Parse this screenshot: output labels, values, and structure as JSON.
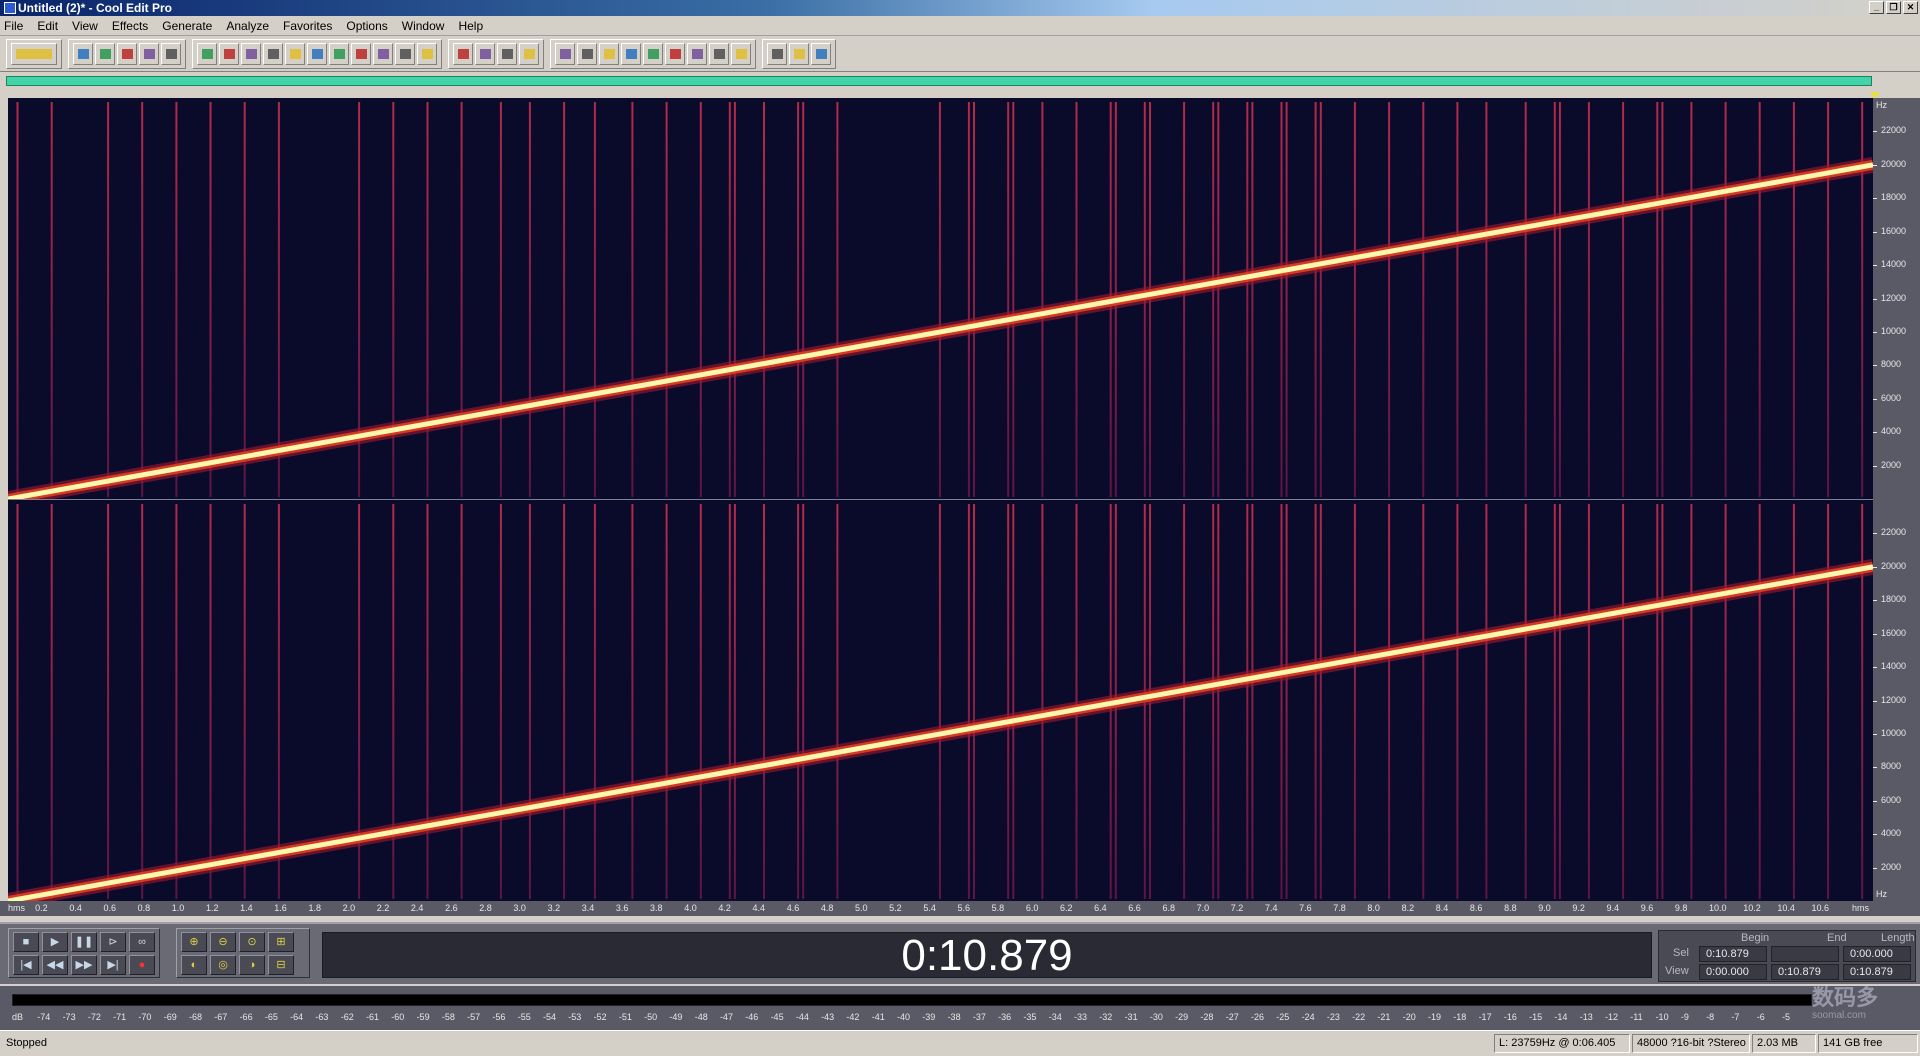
{
  "window": {
    "title": "Untitled (2)* - Cool Edit Pro",
    "controls": [
      "minimize-icon",
      "restore-icon",
      "close-icon"
    ]
  },
  "menu": [
    "File",
    "Edit",
    "View",
    "Effects",
    "Generate",
    "Analyze",
    "Favorites",
    "Options",
    "Window",
    "Help"
  ],
  "toolbar": {
    "groups": [
      [
        "mode-toggle-icon"
      ],
      [
        "new-file-icon",
        "open-file-icon",
        "save-file-icon",
        "save-all-icon",
        "close-file-icon"
      ],
      [
        "undo-icon",
        "redo-icon",
        "repeat-icon",
        "copy-new-icon",
        "copy-icon",
        "cut-icon",
        "paste-icon",
        "paste-new-icon",
        "mix-paste-icon",
        "trim-icon",
        "insert-icon"
      ],
      [
        "spectral-view-icon",
        "waveform-view-icon",
        "edit-view-icon",
        "multitrack-view-icon"
      ],
      [
        "batch-icon",
        "cd-icon",
        "loop-icon",
        "play-list-icon",
        "frequency-icon",
        "counter-icon",
        "grid-icon",
        "meter-icon",
        "info-icon"
      ],
      [
        "scripts-icon",
        "settings-icon",
        "help-icon"
      ]
    ]
  },
  "spectrogram": {
    "channels": 2,
    "freq_max_hz": 24000,
    "sweep_start_hz": 0,
    "sweep_end_hz": 20000,
    "duration_s": 10.879,
    "clicks_at_s": [
      0.05,
      0.25,
      0.58,
      0.78,
      0.98,
      1.18,
      1.38,
      1.58,
      2.05,
      2.25,
      2.45,
      2.65,
      2.88,
      3.05,
      3.25,
      3.43,
      3.65,
      3.85,
      4.05,
      4.22,
      4.25,
      4.42,
      4.62,
      4.65,
      4.85,
      5.45,
      5.62,
      5.65,
      5.85,
      5.88,
      6.05,
      6.25,
      6.45,
      6.48,
      6.65,
      6.68,
      6.88,
      7.05,
      7.08,
      7.25,
      7.28,
      7.45,
      7.48,
      7.65,
      7.68,
      7.88,
      8.08,
      8.28,
      8.48,
      8.65,
      8.88,
      9.05,
      9.08,
      9.25,
      9.45,
      9.65,
      9.68,
      9.85,
      10.05,
      10.25,
      10.45,
      10.65,
      10.85
    ],
    "colors": {
      "bg": "#0a0a2a",
      "sweep": "#fff6b0",
      "sweep_edge": "#e04020",
      "click": "#c02860"
    }
  },
  "hz_scale": {
    "unit": "Hz",
    "ticks": [
      "22000",
      "20000",
      "18000",
      "16000",
      "14000",
      "12000",
      "10000",
      "8000",
      "6000",
      "4000",
      "2000"
    ]
  },
  "time_ruler": {
    "unit_left": "hms",
    "unit_right": "hms",
    "ticks": [
      "0.2",
      "0.4",
      "0.6",
      "0.8",
      "1.0",
      "1.2",
      "1.4",
      "1.6",
      "1.8",
      "2.0",
      "2.2",
      "2.4",
      "2.6",
      "2.8",
      "3.0",
      "3.2",
      "3.4",
      "3.6",
      "3.8",
      "4.0",
      "4.2",
      "4.4",
      "4.6",
      "4.8",
      "5.0",
      "5.2",
      "5.4",
      "5.6",
      "5.8",
      "6.0",
      "6.2",
      "6.4",
      "6.6",
      "6.8",
      "7.0",
      "7.2",
      "7.4",
      "7.6",
      "7.8",
      "8.0",
      "8.2",
      "8.4",
      "8.6",
      "8.8",
      "9.0",
      "9.2",
      "9.4",
      "9.6",
      "9.8",
      "10.0",
      "10.2",
      "10.4",
      "10.6"
    ]
  },
  "transport": {
    "row1": [
      "stop-icon",
      "play-icon",
      "pause-icon",
      "play-to-end-icon",
      "loop-icon"
    ],
    "row2": [
      "go-to-start-icon",
      "rewind-icon",
      "fast-forward-icon",
      "go-to-end-icon",
      "record-icon"
    ],
    "zoom_row1": [
      "zoom-in-icon",
      "zoom-out-icon",
      "zoom-full-icon",
      "zoom-vertical-in-icon"
    ],
    "zoom_row2": [
      "zoom-left-icon",
      "zoom-selection-icon",
      "zoom-right-icon",
      "zoom-vertical-out-icon"
    ]
  },
  "time_display": "0:10.879",
  "selection": {
    "headers": {
      "begin": "Begin",
      "end": "End",
      "length": "Length"
    },
    "sel": {
      "label": "Sel",
      "begin": "0:10.879",
      "end": "",
      "length": "0:00.000"
    },
    "view": {
      "label": "View",
      "begin": "0:00.000",
      "end": "0:10.879",
      "length": "0:10.879"
    }
  },
  "level_meter": {
    "ticks": [
      "dB",
      "-74",
      "-73",
      "-72",
      "-71",
      "-70",
      "-69",
      "-68",
      "-67",
      "-66",
      "-65",
      "-64",
      "-63",
      "-62",
      "-61",
      "-60",
      "-59",
      "-58",
      "-57",
      "-56",
      "-55",
      "-54",
      "-53",
      "-52",
      "-51",
      "-50",
      "-49",
      "-48",
      "-47",
      "-46",
      "-45",
      "-44",
      "-43",
      "-42",
      "-41",
      "-40",
      "-39",
      "-38",
      "-37",
      "-36",
      "-35",
      "-34",
      "-33",
      "-32",
      "-31",
      "-30",
      "-29",
      "-28",
      "-27",
      "-26",
      "-25",
      "-24",
      "-23",
      "-22",
      "-21",
      "-20",
      "-19",
      "-18",
      "-17",
      "-16",
      "-15",
      "-14",
      "-13",
      "-12",
      "-11",
      "-10",
      "-9",
      "-8",
      "-7",
      "-6",
      "-5"
    ]
  },
  "watermark": {
    "text": "数码多",
    "subtext": "soomal.com"
  },
  "status": {
    "state": "Stopped",
    "cursor": "L: 23759Hz @  0:06.405",
    "format": "48000 ?16-bit ?Stereo",
    "size": "2.03 MB",
    "free": "141 GB free"
  }
}
